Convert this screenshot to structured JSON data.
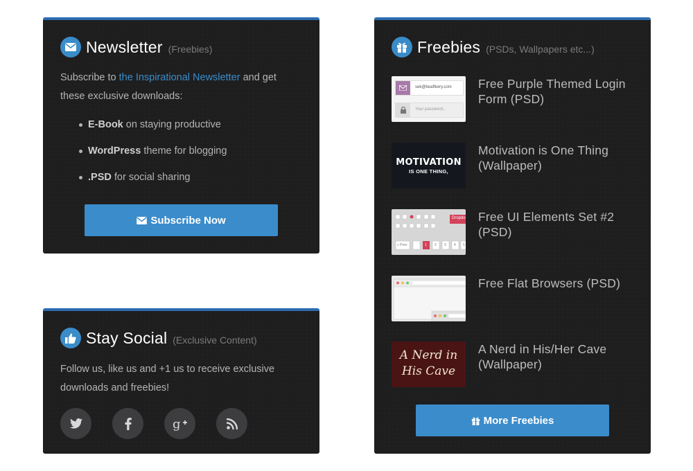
{
  "newsletter": {
    "title": "Newsletter",
    "subtitle": "(Freebies)",
    "intro_pre": "Subscribe to ",
    "intro_link": "the Inspirational Newsletter",
    "intro_post": " and get these exclusive downloads:",
    "items": [
      {
        "bold": "E-Book",
        "rest": " on staying productive"
      },
      {
        "bold": "WordPress",
        "rest": " theme for blogging"
      },
      {
        "bold": ".PSD",
        "rest": " for social sharing"
      }
    ],
    "button_label": "Subscribe Now",
    "icon": "envelope-icon"
  },
  "social": {
    "title": "Stay Social",
    "subtitle": "(Exclusive Content)",
    "text": "Follow us, like us and +1 us to receive exclusive downloads and freebies!",
    "icon": "thumbs-up-icon",
    "networks": [
      "twitter-icon",
      "facebook-icon",
      "google-plus-icon",
      "rss-icon"
    ]
  },
  "freebies": {
    "title": "Freebies",
    "subtitle": "(PSDs, Wallpapers etc...)",
    "icon": "gift-icon",
    "items": [
      {
        "title": "Free Purple Themed Login Form (PSD)",
        "thumb": {
          "email": "sek@beaftkery.com",
          "password": "Your password..."
        }
      },
      {
        "title": "Motivation is One Thing (Wallpaper)",
        "thumb": {
          "line1": "MOTIVATION",
          "line2": "IS ONE THING,"
        }
      },
      {
        "title": "Free UI Elements Set #2 (PSD)",
        "thumb": {
          "badge": "Dropdo",
          "prev": "« Prev",
          "pages": [
            "1",
            "2",
            "3",
            "4",
            "5"
          ]
        }
      },
      {
        "title": "Free Flat Browsers (PSD)",
        "thumb": {}
      },
      {
        "title": "A Nerd in His/Her Cave (Wallpaper)",
        "thumb": {
          "line1": "A Nerd in",
          "line2": "His Cave"
        }
      }
    ],
    "button_label": "More Freebies"
  },
  "colors": {
    "accent": "#3b8ccb",
    "panel": "#1e1e1f",
    "link": "#3a8cc9"
  }
}
